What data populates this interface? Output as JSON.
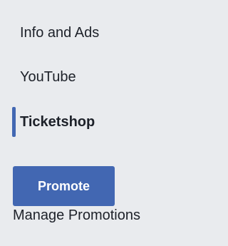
{
  "sidebar": {
    "items": [
      {
        "label": "Info and Ads",
        "active": false
      },
      {
        "label": "YouTube",
        "active": false
      },
      {
        "label": "Ticketshop",
        "active": true
      }
    ]
  },
  "promote": {
    "label": "Promote"
  },
  "manage_promotions": {
    "label": "Manage Promotions"
  },
  "colors": {
    "accent": "#4267b2",
    "background": "#e9ebee",
    "text": "#1d2129"
  }
}
